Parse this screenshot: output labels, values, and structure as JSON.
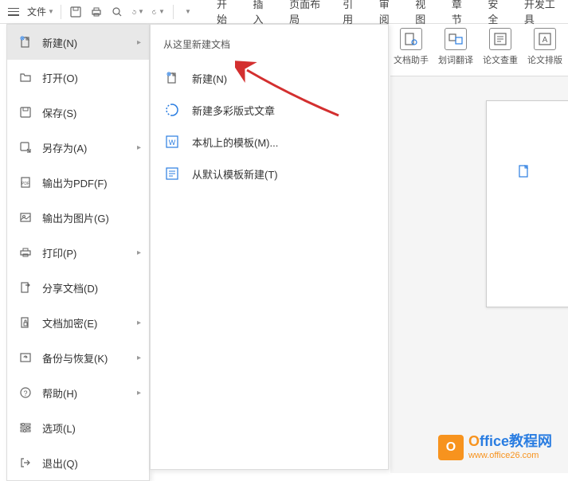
{
  "toolbar": {
    "file_label": "文件"
  },
  "ribbon": {
    "tabs": [
      "开始",
      "插入",
      "页面布局",
      "引用",
      "审阅",
      "视图",
      "章节",
      "安全",
      "开发工具"
    ]
  },
  "tools": [
    {
      "label": "文档助手"
    },
    {
      "label": "划词翻译"
    },
    {
      "label": "论文查重"
    },
    {
      "label": "论文排版"
    }
  ],
  "file_menu": [
    {
      "label": "新建(N)",
      "icon": "new",
      "has_sub": true,
      "active": true
    },
    {
      "label": "打开(O)",
      "icon": "open",
      "has_sub": false
    },
    {
      "label": "保存(S)",
      "icon": "save",
      "has_sub": false
    },
    {
      "label": "另存为(A)",
      "icon": "saveas",
      "has_sub": true
    },
    {
      "label": "输出为PDF(F)",
      "icon": "pdf",
      "has_sub": false
    },
    {
      "label": "输出为图片(G)",
      "icon": "image",
      "has_sub": false
    },
    {
      "label": "打印(P)",
      "icon": "print",
      "has_sub": true
    },
    {
      "label": "分享文档(D)",
      "icon": "share",
      "has_sub": false
    },
    {
      "label": "文档加密(E)",
      "icon": "encrypt",
      "has_sub": true
    },
    {
      "label": "备份与恢复(K)",
      "icon": "backup",
      "has_sub": true
    },
    {
      "label": "帮助(H)",
      "icon": "help",
      "has_sub": true
    },
    {
      "label": "选项(L)",
      "icon": "options",
      "has_sub": false
    },
    {
      "label": "退出(Q)",
      "icon": "exit",
      "has_sub": false
    }
  ],
  "submenu": {
    "title": "从这里新建文档",
    "items": [
      {
        "label": "新建(N)",
        "icon": "new"
      },
      {
        "label": "新建多彩版式文章",
        "icon": "colorful"
      },
      {
        "label": "本机上的模板(M)...",
        "icon": "template"
      },
      {
        "label": "从默认模板新建(T)",
        "icon": "default-template"
      }
    ]
  },
  "watermark": {
    "title_part1": "O",
    "title_part2": "ffice教程网",
    "url": "www.office26.com"
  }
}
